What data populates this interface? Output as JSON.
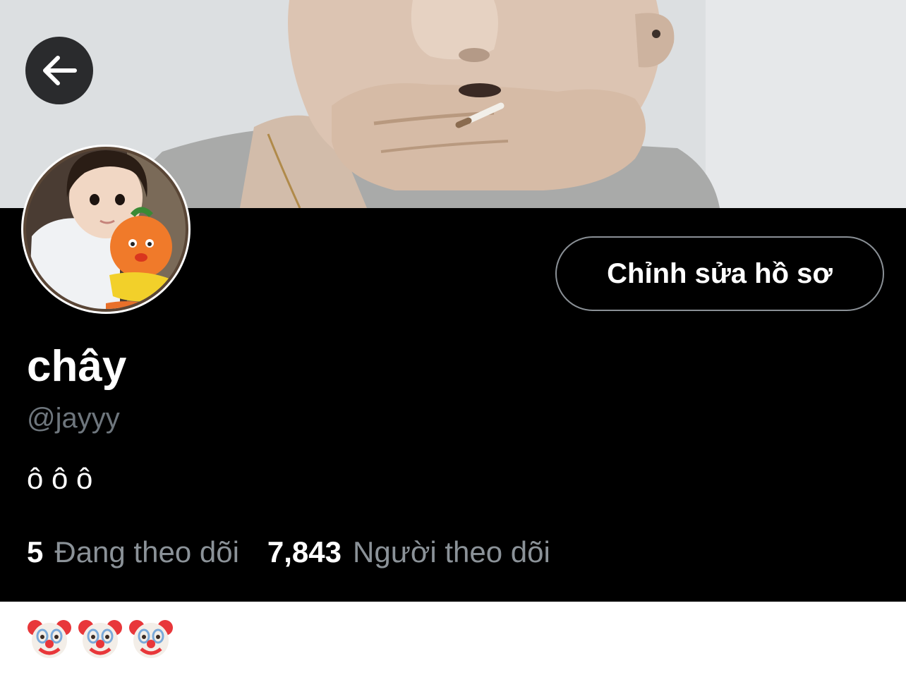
{
  "header": {
    "back_icon": "arrow-left-icon",
    "banner_image": "cover-photo-person-hand-over-mouth"
  },
  "profile": {
    "avatar_image": "child-holding-orange-toy",
    "edit_button_label": "Chỉnh sửa hồ sơ",
    "display_name": "chây",
    "handle": "@jayyy",
    "bio": "ô ô ô",
    "following_count": "5",
    "following_label": "Đang theo dõi",
    "followers_count": "7,843",
    "followers_label": "Người theo dõi"
  },
  "caption": {
    "emojis": [
      "🤡",
      "🤡",
      "🤡"
    ],
    "emoji_icon": "clown-face-icon"
  },
  "colors": {
    "panel_background": "#000000",
    "primary_text": "#ffffff",
    "secondary_text": "#6e767d",
    "button_border": "#8a9096",
    "caption_background": "#ffffff"
  }
}
